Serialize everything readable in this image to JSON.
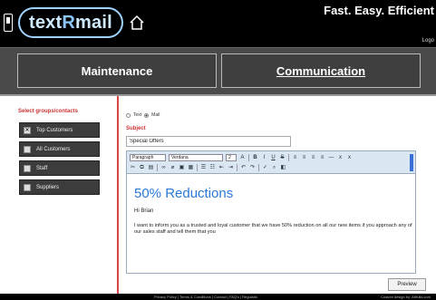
{
  "header": {
    "logo_text_a": "text",
    "logo_text_b": "R",
    "logo_text_c": "mail",
    "tagline": "Fast. Easy. Efficient",
    "logout": "Logo"
  },
  "nav": {
    "maintenance": "Maintenance",
    "communication": "Communication"
  },
  "sidebar": {
    "title": "Select groups/contacts",
    "groups": [
      {
        "label": "Top Customers",
        "checked": true
      },
      {
        "label": "All Customers",
        "checked": false
      },
      {
        "label": "Staff",
        "checked": false
      },
      {
        "label": "Suppliers",
        "checked": false
      }
    ]
  },
  "compose": {
    "radio_text": "Text",
    "radio_mail": "Mail",
    "selected_mode": "Mail",
    "subject_label": "Subject",
    "subject_value": "Special Offers",
    "toolbar": {
      "format": "Paragraph",
      "font": "Verdana",
      "size": "2"
    },
    "body_heading": "50% Reductions",
    "body_greeting": "Hi Brian",
    "body_paragraph": "I want to inform you as a trusted and loyal customer that we have 50% reduction on all our new items if you approach any of our sales staff and tell them that you",
    "preview_label": "Preview"
  },
  "footer": {
    "links": "Privacy Policy | Terms & Conditions | Contact | FAQ's | Regulatio",
    "credit": "Custom design by: Artfulls.com"
  },
  "colors": {
    "accent_red": "#cc3333",
    "heading_blue": "#2b78d9",
    "nav_bg": "#4a4a4a"
  }
}
